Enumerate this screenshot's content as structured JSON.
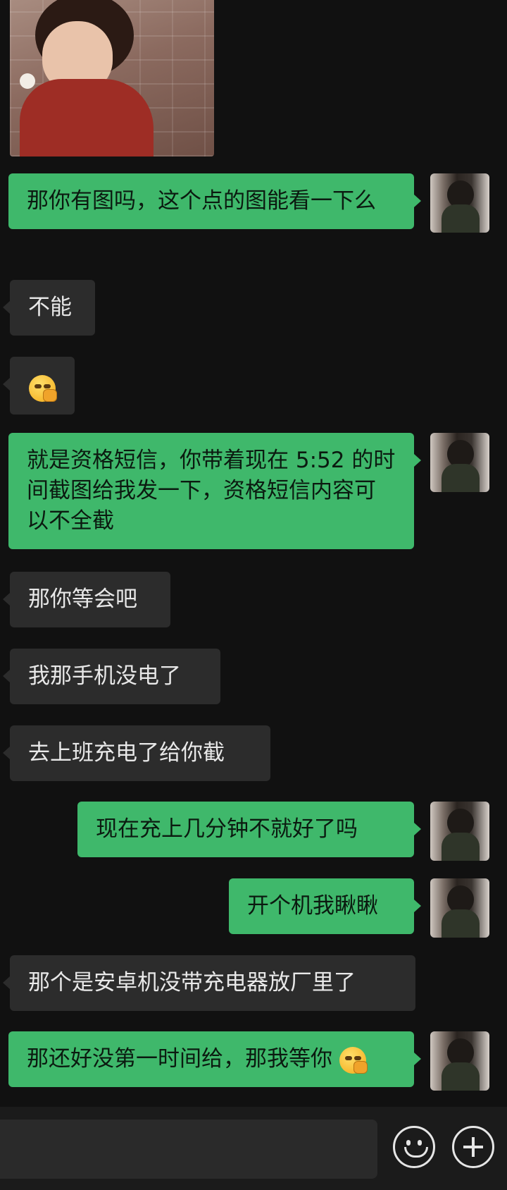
{
  "messages": [
    {
      "id": "m1",
      "side": "out",
      "text": "那你有图吗，这个点的图能看一下么"
    },
    {
      "id": "m2",
      "side": "in",
      "text": "不能"
    },
    {
      "id": "m3",
      "side": "in",
      "emoji": "hand-over-mouth-face"
    },
    {
      "id": "m4",
      "side": "out",
      "text": "就是资格短信，你带着现在 5:52 的时间截图给我发一下，资格短信内容可以不全截"
    },
    {
      "id": "m5",
      "side": "in",
      "text": "那你等会吧"
    },
    {
      "id": "m6",
      "side": "in",
      "text": "我那手机没电了"
    },
    {
      "id": "m7",
      "side": "in",
      "text": "去上班充电了给你截"
    },
    {
      "id": "m8",
      "side": "out",
      "text": "现在充上几分钟不就好了吗"
    },
    {
      "id": "m9",
      "side": "out",
      "text": "开个机我瞅瞅"
    },
    {
      "id": "m10",
      "side": "in",
      "text": "那个是安卓机没带充电器放厂里了"
    },
    {
      "id": "m11",
      "side": "out",
      "text": "那还好没第一时间给，那我等你",
      "trailing_emoji": "hand-over-mouth-face"
    }
  ],
  "colors": {
    "background": "#111111",
    "outgoing_bubble": "#3fb86b",
    "incoming_bubble": "#2c2c2c"
  },
  "input_bar": {
    "icons": [
      "emoji-icon",
      "plus-icon"
    ]
  }
}
